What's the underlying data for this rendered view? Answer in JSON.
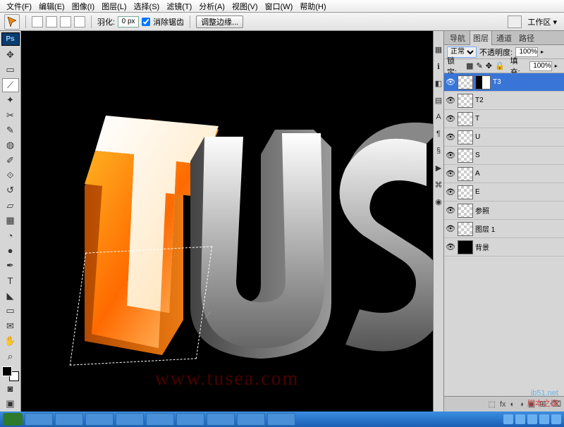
{
  "menu": [
    "文件(F)",
    "编辑(E)",
    "图像(I)",
    "图层(L)",
    "选择(S)",
    "滤镜(T)",
    "分析(A)",
    "视图(V)",
    "窗口(W)",
    "帮助(H)"
  ],
  "optbar": {
    "feather_label": "羽化:",
    "feather_value": "0 px",
    "antialias_label": "消除锯齿",
    "refine_btn": "调整边缘...",
    "workspace_label": "工作区 ▾"
  },
  "tools": [
    "▭",
    "◐",
    "⟋",
    "✂",
    "✎",
    "⌁",
    "∅",
    "✐",
    "⟲",
    "▢",
    "◑",
    "⬚",
    "✎",
    "◔",
    "●",
    "⟋",
    "T",
    "◣",
    "▭",
    "✋",
    "⌕",
    "⟳"
  ],
  "vstrip": [
    "▦",
    "⊞",
    "◧",
    "⟐",
    "A",
    "¶",
    "§",
    "⊞",
    "⌘",
    "◉",
    "⬚"
  ],
  "layers_panel": {
    "tabs": [
      "导航",
      "图层",
      "通道",
      "路径"
    ],
    "active_tab": "图层",
    "blend_label": "正常",
    "opacity_label": "不透明度:",
    "opacity_value": "100%",
    "lock_label": "锁定:",
    "fill_label": "填充:",
    "fill_value": "100%",
    "layers": [
      {
        "name": "T3",
        "sel": true,
        "mask": true,
        "checker": true
      },
      {
        "name": "T2",
        "checker": true
      },
      {
        "name": "T",
        "checker": true
      },
      {
        "name": "U",
        "checker": true
      },
      {
        "name": "S",
        "checker": true
      },
      {
        "name": "A",
        "checker": true
      },
      {
        "name": "E",
        "checker": true
      },
      {
        "name": "参照",
        "checker": true
      },
      {
        "name": "图层 1",
        "checker": true
      },
      {
        "name": "背景",
        "bg": true
      }
    ],
    "foot_icons": [
      "⬚",
      "fx",
      "◐",
      "▣",
      "⊡",
      "⊞",
      "⌫"
    ]
  },
  "canvas": {
    "letters": "tusea",
    "watermark": "www.tusea.com"
  },
  "corner": {
    "line1": "jb51.net",
    "line2": "脚本之家"
  }
}
